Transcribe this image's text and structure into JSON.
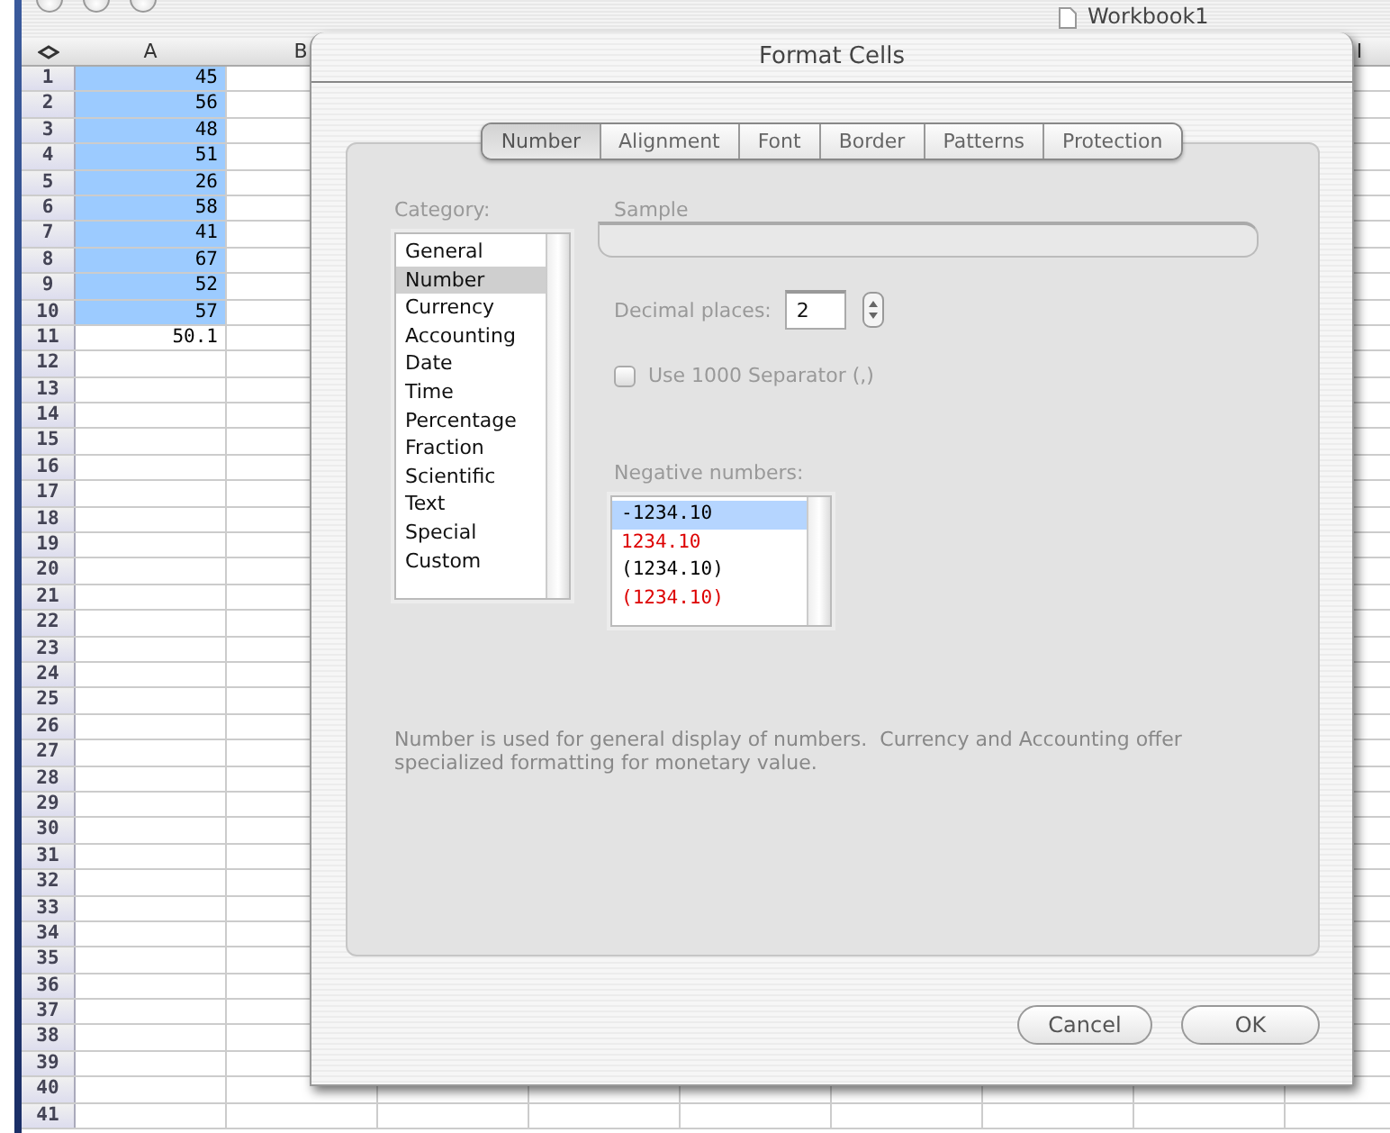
{
  "window": {
    "title": "Workbook1"
  },
  "sheet": {
    "columns": [
      "A",
      "B",
      "I"
    ],
    "rows": [
      {
        "number": "1",
        "a": "45",
        "selected": true
      },
      {
        "number": "2",
        "a": "56",
        "selected": true
      },
      {
        "number": "3",
        "a": "48",
        "selected": true
      },
      {
        "number": "4",
        "a": "51",
        "selected": true
      },
      {
        "number": "5",
        "a": "26",
        "selected": true
      },
      {
        "number": "6",
        "a": "58",
        "selected": true
      },
      {
        "number": "7",
        "a": "41",
        "selected": true
      },
      {
        "number": "8",
        "a": "67",
        "selected": true
      },
      {
        "number": "9",
        "a": "52",
        "selected": true
      },
      {
        "number": "10",
        "a": "57",
        "selected": true
      },
      {
        "number": "11",
        "a": "50.1",
        "selected": false
      },
      {
        "number": "12"
      },
      {
        "number": "13"
      },
      {
        "number": "14"
      },
      {
        "number": "15"
      },
      {
        "number": "16"
      },
      {
        "number": "17"
      },
      {
        "number": "18"
      },
      {
        "number": "19"
      },
      {
        "number": "20"
      },
      {
        "number": "21"
      },
      {
        "number": "22"
      },
      {
        "number": "23"
      },
      {
        "number": "24"
      },
      {
        "number": "25"
      },
      {
        "number": "26"
      },
      {
        "number": "27"
      },
      {
        "number": "28"
      },
      {
        "number": "29"
      },
      {
        "number": "30"
      },
      {
        "number": "31"
      },
      {
        "number": "32"
      },
      {
        "number": "33"
      },
      {
        "number": "34"
      },
      {
        "number": "35"
      },
      {
        "number": "36"
      },
      {
        "number": "37"
      },
      {
        "number": "38"
      },
      {
        "number": "39"
      },
      {
        "number": "40"
      },
      {
        "number": "41"
      }
    ]
  },
  "dialog": {
    "title": "Format Cells",
    "tabs": [
      {
        "label": "Number",
        "selected": true
      },
      {
        "label": "Alignment",
        "selected": false
      },
      {
        "label": "Font",
        "selected": false
      },
      {
        "label": "Border",
        "selected": false
      },
      {
        "label": "Patterns",
        "selected": false
      },
      {
        "label": "Protection",
        "selected": false
      }
    ],
    "category_label": "Category:",
    "categories": [
      {
        "label": "General",
        "selected": false
      },
      {
        "label": "Number",
        "selected": true
      },
      {
        "label": "Currency",
        "selected": false
      },
      {
        "label": "Accounting",
        "selected": false
      },
      {
        "label": "Date",
        "selected": false
      },
      {
        "label": "Time",
        "selected": false
      },
      {
        "label": "Percentage",
        "selected": false
      },
      {
        "label": "Fraction",
        "selected": false
      },
      {
        "label": "Scientific",
        "selected": false
      },
      {
        "label": "Text",
        "selected": false
      },
      {
        "label": "Special",
        "selected": false
      },
      {
        "label": "Custom",
        "selected": false
      }
    ],
    "sample_label": "Sample",
    "decimal_places": {
      "label": "Decimal places:",
      "value": "2"
    },
    "separator": {
      "label": "Use 1000 Separator (,)",
      "checked": false
    },
    "negative_label": "Negative numbers:",
    "negative_numbers": [
      {
        "label": "-1234.10",
        "color": "#000000",
        "selected": true
      },
      {
        "label": "1234.10",
        "color": "#dd0000",
        "selected": false
      },
      {
        "label": "(1234.10)",
        "color": "#000000",
        "selected": false
      },
      {
        "label": "(1234.10)",
        "color": "#dd0000",
        "selected": false
      }
    ],
    "description": "Number is used for general display of numbers.  Currency and Accounting offer specialized formatting for monetary value.",
    "buttons": [
      "Cancel",
      "OK"
    ]
  }
}
